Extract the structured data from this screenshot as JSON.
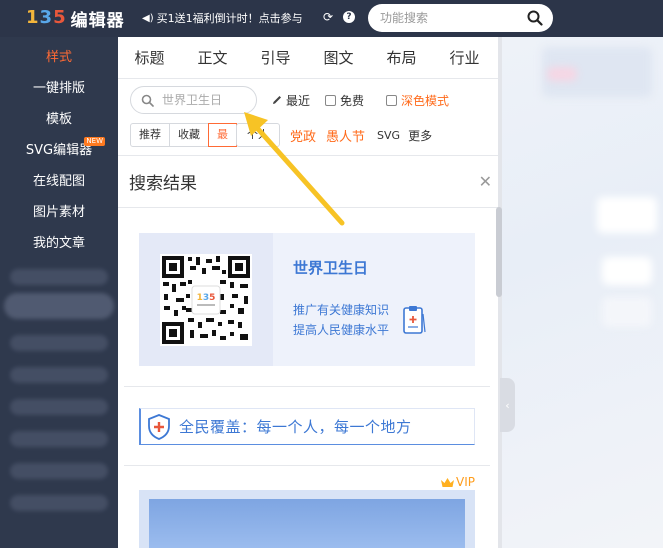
{
  "header": {
    "logo_mark": "135",
    "logo_text": "编辑器",
    "promo_text": "买1送1福利倒计时！点击参与",
    "search_placeholder": "功能搜索"
  },
  "sidebar": {
    "items": [
      {
        "label": "样式",
        "active": true
      },
      {
        "label": "一键排版"
      },
      {
        "label": "模板"
      },
      {
        "label": "SVG编辑器",
        "badge": "NEW"
      },
      {
        "label": "在线配图"
      },
      {
        "label": "图片素材"
      },
      {
        "label": "我的文章"
      }
    ]
  },
  "panel": {
    "tabs": [
      "标题",
      "正文",
      "引导",
      "图文",
      "布局",
      "行业"
    ],
    "search_value": "世界卫生日",
    "latest_label": "最近",
    "free_label": "免费",
    "dark_mode_label": "深色模式",
    "chips": [
      "推荐",
      "收藏",
      "最",
      "个人"
    ],
    "keywords": [
      "党政",
      "愚人节"
    ],
    "svg_label": "SVG",
    "more_label": "更多",
    "results_title": "搜索结果",
    "card1": {
      "title": "世界卫生日",
      "line1": "推广有关健康知识",
      "line2": "提高人民健康水平"
    },
    "card2_slogan": "全民覆盖：每一个人，每一个地方",
    "vip_label": "VIP"
  },
  "colors": {
    "header_bg": "#2c3549",
    "sidebar_bg": "#2f394d",
    "accent_orange": "#ff6a35",
    "card_blue": "#3d78d4",
    "arrow_yellow": "#f7c325"
  }
}
